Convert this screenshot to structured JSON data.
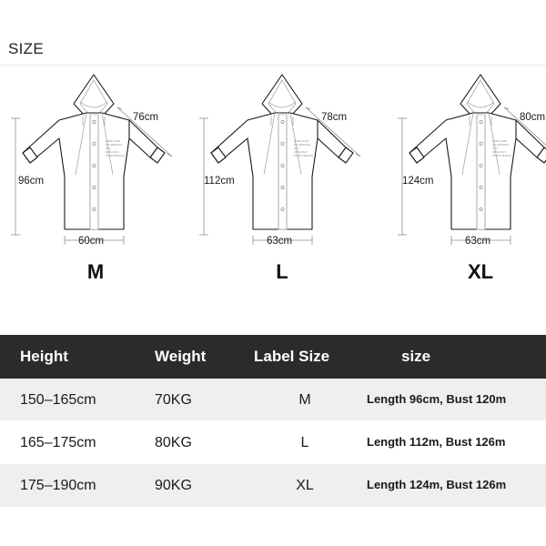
{
  "header": {
    "title": "SIZE"
  },
  "diagrams": [
    {
      "key": "m",
      "size_letter": "M",
      "sleeve": "76cm",
      "length": "96cm",
      "width": "60cm"
    },
    {
      "key": "l",
      "size_letter": "L",
      "sleeve": "78cm",
      "length": "112cm",
      "width": "63cm"
    },
    {
      "key": "xl",
      "size_letter": "XL",
      "sleeve": "80cm",
      "length": "124cm",
      "width": "63cm"
    }
  ],
  "table": {
    "headers": {
      "height": "Height",
      "weight": "Weight",
      "label_size": "Label Size",
      "size": "size"
    },
    "rows": [
      {
        "height": "150–165cm",
        "weight": "70KG",
        "label_size": "M",
        "size": "Length 96cm, Bust 120m"
      },
      {
        "height": "165–175cm",
        "weight": "80KG",
        "label_size": "L",
        "size": "Length 112m, Bust 126m"
      },
      {
        "height": "175–190cm",
        "weight": "90KG",
        "label_size": "XL",
        "size": "Length 124m, Bust 126m"
      }
    ]
  },
  "colors": {
    "header_bar": "#2b2b2b",
    "row_alt": "#efefed",
    "row_base": "#ffffff",
    "text": "#1a1a1a",
    "dimension_line": "#8e8e8e"
  }
}
